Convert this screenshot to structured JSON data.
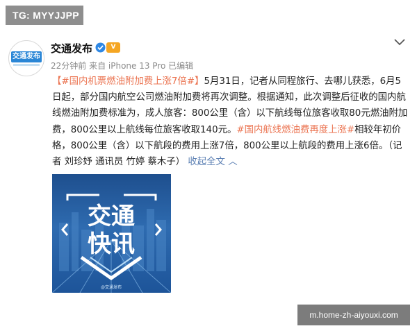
{
  "watermark_top": "TG: MYYJJPP",
  "author": {
    "name": "交通发布",
    "avatar_text": "交通发布",
    "level_badge": "V"
  },
  "meta": "22分钟前 来自 iPhone 13 Pro 已编辑",
  "post": {
    "hashtag1": "【#国内机票燃油附加费上涨7倍#】",
    "body1": "5月31日，记者从同程旅行、去哪儿获悉，6月5日起，部分国内航空公司燃油附加费将再次调整。根据通知，此次调整后征收的国内航线燃油附加费标准为，成人旅客：800公里（含）以下航线每位旅客收取80元燃油附加费，800公里以上航线每位旅客收取140元。",
    "hashtag2": "#国内航线燃油费再度上涨#",
    "body2": "相较年初价格，800公里（含）以下航段的费用上涨7倍，800公里以上航段的费用上涨6倍。（记者 刘珍妤 通讯员 竹婷 蔡木子）",
    "collapse": "收起全文"
  },
  "image": {
    "title_line1": "交通",
    "title_line2": "快讯",
    "caption": "@交通发布"
  },
  "watermark_bottom": "m.home-zh-aiyouxi.com",
  "colors": {
    "hashtag": "#eb7350",
    "link": "#5b7fb3",
    "image_bg": "#2a63a8"
  }
}
